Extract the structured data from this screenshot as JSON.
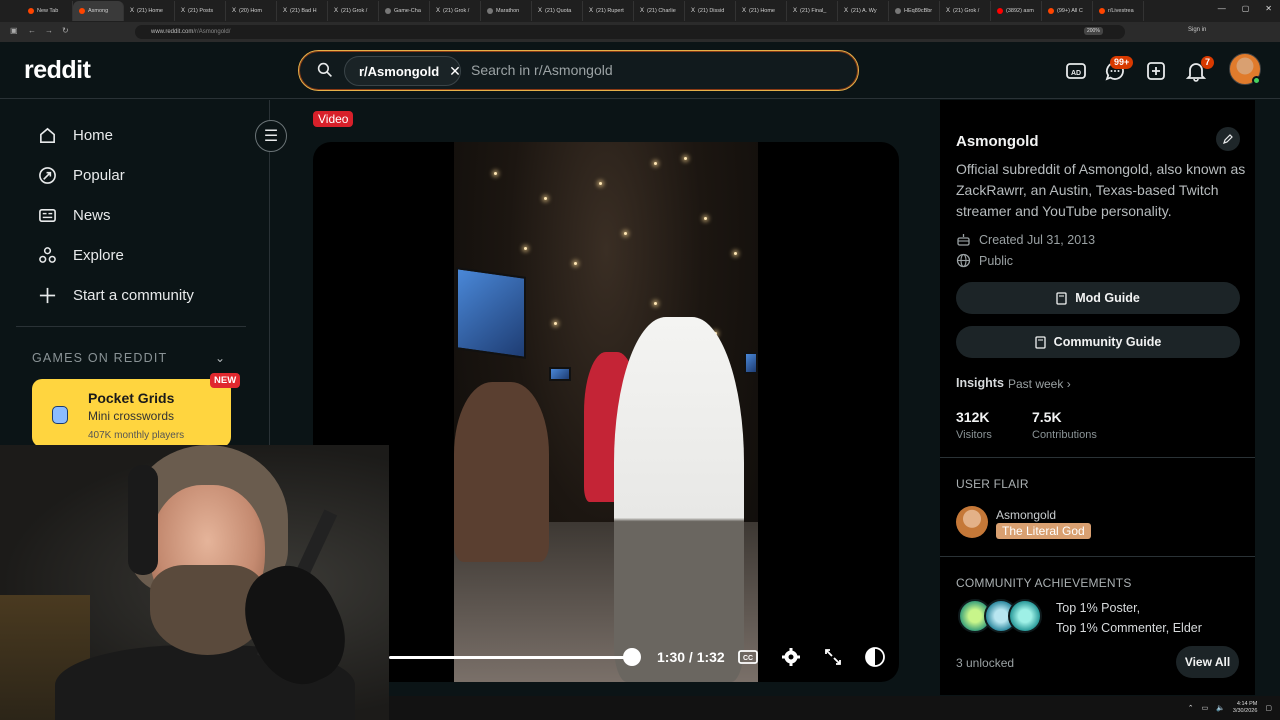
{
  "browser": {
    "tabs": [
      {
        "label": "New Tab",
        "icon": "reddit-favicon"
      },
      {
        "label": "Asmong",
        "icon": "reddit-favicon",
        "active": true
      },
      {
        "label": "(21) Home",
        "icon": "x-favicon"
      },
      {
        "label": "(21) Posts",
        "icon": "x-favicon"
      },
      {
        "label": "(20) Hom",
        "icon": "x-favicon"
      },
      {
        "label": "(21) Bad H",
        "icon": "x-favicon"
      },
      {
        "label": "(21) Grok /",
        "icon": "x-favicon"
      },
      {
        "label": "Game-Cha",
        "icon": "page-favicon"
      },
      {
        "label": "(21) Grok /",
        "icon": "x-favicon"
      },
      {
        "label": "Marathon",
        "icon": "page-favicon"
      },
      {
        "label": "(21) Quota",
        "icon": "x-favicon"
      },
      {
        "label": "(21) Rupert",
        "icon": "x-favicon"
      },
      {
        "label": "(21) Charlie",
        "icon": "x-favicon"
      },
      {
        "label": "(21) Dissid",
        "icon": "x-favicon"
      },
      {
        "label": "(21) Home",
        "icon": "x-favicon"
      },
      {
        "label": "(21) Final_",
        "icon": "x-favicon"
      },
      {
        "label": "(21) A. Wy",
        "icon": "x-favicon"
      },
      {
        "label": "HEq89cBbr",
        "icon": "page-favicon"
      },
      {
        "label": "(21) Grok /",
        "icon": "x-favicon"
      },
      {
        "label": "(3892) asm",
        "icon": "youtube-favicon"
      },
      {
        "label": "(99+) All C",
        "icon": "reddit-favicon"
      },
      {
        "label": "r/Livestrea",
        "icon": "reddit-favicon"
      }
    ],
    "url_host": "www.reddit.com",
    "url_path": "/r/Asmongold/",
    "zoom": "200%",
    "signin_label": "Sign in"
  },
  "header": {
    "logo": "reddit",
    "search_chip": "r/Asmongold",
    "search_placeholder": "Search in r/Asmongold",
    "chat_badge": "99+",
    "notif_badge": "7"
  },
  "left_nav": {
    "items": [
      {
        "label": "Home",
        "icon": "home-icon"
      },
      {
        "label": "Popular",
        "icon": "popular-icon"
      },
      {
        "label": "News",
        "icon": "news-icon"
      },
      {
        "label": "Explore",
        "icon": "explore-icon"
      },
      {
        "label": "Start a community",
        "icon": "plus-icon"
      }
    ],
    "games_title": "GAMES ON REDDIT",
    "game": {
      "title": "Pocket Grids",
      "subtitle": "Mini crosswords",
      "players": "407K monthly players",
      "badge": "NEW"
    }
  },
  "post": {
    "flair": "Video",
    "player": {
      "progress_fraction": 0.98,
      "time": "1:30 / 1:32"
    }
  },
  "community": {
    "name": "Asmongold",
    "description": "Official subreddit of Asmongold, also known as ZackRawrr, an Austin, Texas-based Twitch streamer and YouTube personality.",
    "created": "Created Jul 31, 2013",
    "visibility": "Public",
    "mod_guide": "Mod Guide",
    "community_guide": "Community Guide",
    "insights_label": "Insights",
    "insights_period": "Past week",
    "visitors_value": "312K",
    "visitors_label": "Visitors",
    "contributions_value": "7.5K",
    "contributions_label": "Contributions",
    "user_flair_title": "USER FLAIR",
    "flair_user": "Asmongold",
    "flair_text": "The Literal God",
    "achievements_title": "COMMUNITY ACHIEVEMENTS",
    "achievement_line1": "Top 1% Poster,",
    "achievement_line2": "Top 1% Commenter, Elder",
    "unlocked": "3 unlocked",
    "view_all": "View All"
  },
  "taskbar": {
    "time": "4:14 PM",
    "date": "3/30/2026"
  },
  "colors": {
    "reddit_orange": "#ff4500",
    "badge_red": "#d93a00",
    "pocket_yellow": "#ffd53f",
    "flair_tan": "#d9a071",
    "search_border": "#e6b04a"
  }
}
